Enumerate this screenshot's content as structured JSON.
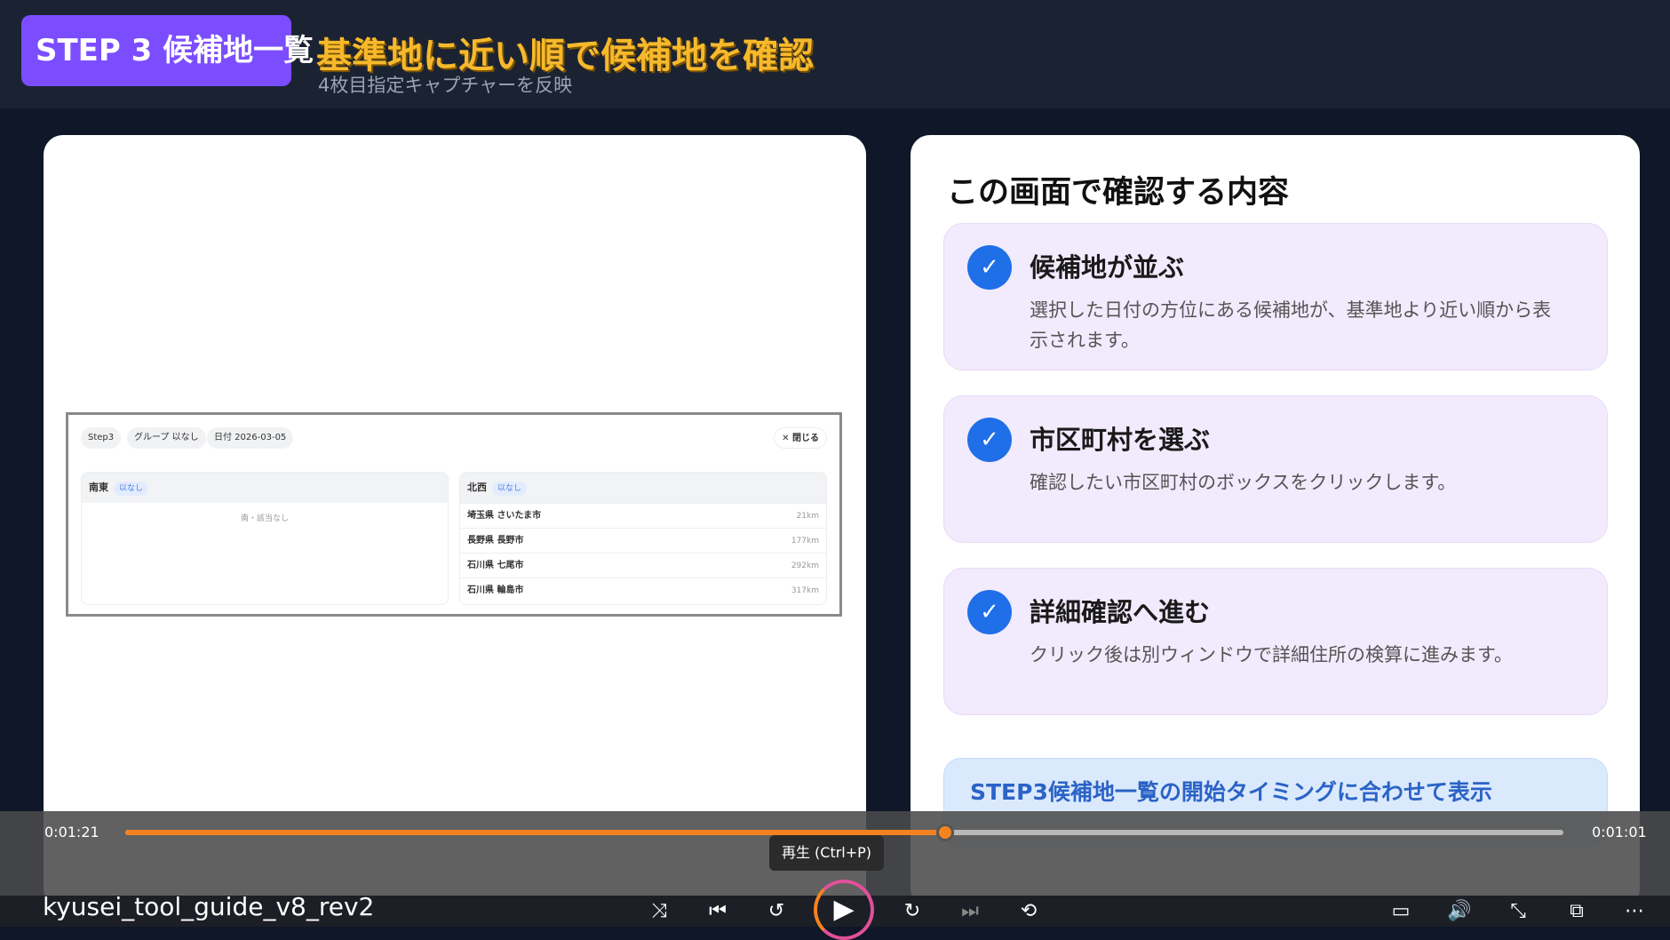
{
  "header": {
    "badge": "STEP 3  候補地一覧",
    "title": "基準地に近い順で候補地を確認",
    "subtitle": "4枚目指定キャプチャーを反映"
  },
  "capture": {
    "chips": [
      "Step3",
      "グループ  以なし",
      "日付  2026-03-05"
    ],
    "close": "✕ 閉じる",
    "left_col": {
      "name": "南東",
      "tag": "以なし",
      "empty": "南・該当なし"
    },
    "right_col": {
      "name": "北西",
      "tag": "以なし",
      "rows": [
        {
          "place": "埼玉県 さいたま市",
          "dist": "21km"
        },
        {
          "place": "長野県 長野市",
          "dist": "177km"
        },
        {
          "place": "石川県 七尾市",
          "dist": "292km"
        },
        {
          "place": "石川県 輪島市",
          "dist": "317km"
        }
      ]
    }
  },
  "panel": {
    "heading": "この画面で確認する内容",
    "items": [
      {
        "title": "候補地が並ぶ",
        "desc": "選択した日付の方位にある候補地が、基準地より近い順から表示されます。"
      },
      {
        "title": "市区町村を選ぶ",
        "desc": "確認したい市区町村のボックスをクリックします。"
      },
      {
        "title": "詳細確認へ進む",
        "desc": "クリック後は別ウィンドウで詳細住所の検算に進みます。"
      }
    ],
    "banner": "STEP3候補地一覧の開始タイミングに合わせて表示"
  },
  "player": {
    "elapsed": "0:01:21",
    "remaining": "0:01:01",
    "progress_fraction": 0.57,
    "tooltip": "再生 (Ctrl+P)",
    "video_title": "kyusei_tool_guide_v8_rev2",
    "icons": {
      "shuffle": "⤨",
      "previous": "⏮",
      "rewind": "↺",
      "play": "▶",
      "forward": "↻",
      "next": "⏭",
      "repeat": "⟲",
      "captions": "▭",
      "volume": "🔊",
      "minimize": "⤡",
      "miniplayer": "⧉",
      "more": "⋯"
    }
  }
}
